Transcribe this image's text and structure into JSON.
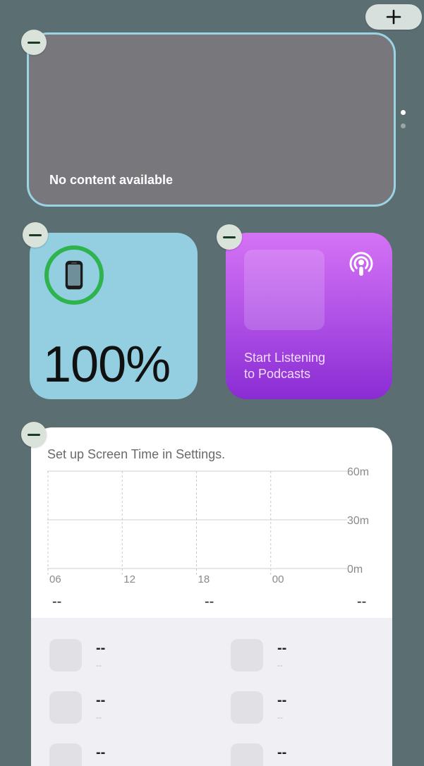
{
  "add_button": {
    "icon": "plus-icon"
  },
  "photos_widget": {
    "message": "No content available",
    "page_dots": [
      {
        "color": "#ffffff",
        "active": true
      },
      {
        "color": "#9aa6a8",
        "active": false
      }
    ]
  },
  "battery_widget": {
    "icon": "iphone-icon",
    "percent": "100%",
    "ring_color": "#2fb34e",
    "level": 1.0
  },
  "podcasts_widget": {
    "icon": "podcasts-icon",
    "line1": "Start Listening",
    "line2": "to Podcasts"
  },
  "screentime_widget": {
    "title": "Set up Screen Time in Settings.",
    "chart_data": {
      "type": "bar",
      "categories": [
        "06",
        "12",
        "18",
        "00"
      ],
      "y_ticks": [
        "60m",
        "30m",
        "0m"
      ],
      "ylim": [
        0,
        60
      ],
      "values": []
    },
    "stats": [
      "--",
      "--",
      "--"
    ],
    "apps": [
      {
        "value": "--",
        "sub": "--"
      },
      {
        "value": "--",
        "sub": "--"
      },
      {
        "value": "--",
        "sub": "--"
      },
      {
        "value": "--",
        "sub": "--"
      },
      {
        "value": "--",
        "sub": "--"
      },
      {
        "value": "--",
        "sub": "--"
      }
    ]
  },
  "colors": {
    "background": "#5b6e72",
    "accent_border": "#9ad3e3"
  }
}
